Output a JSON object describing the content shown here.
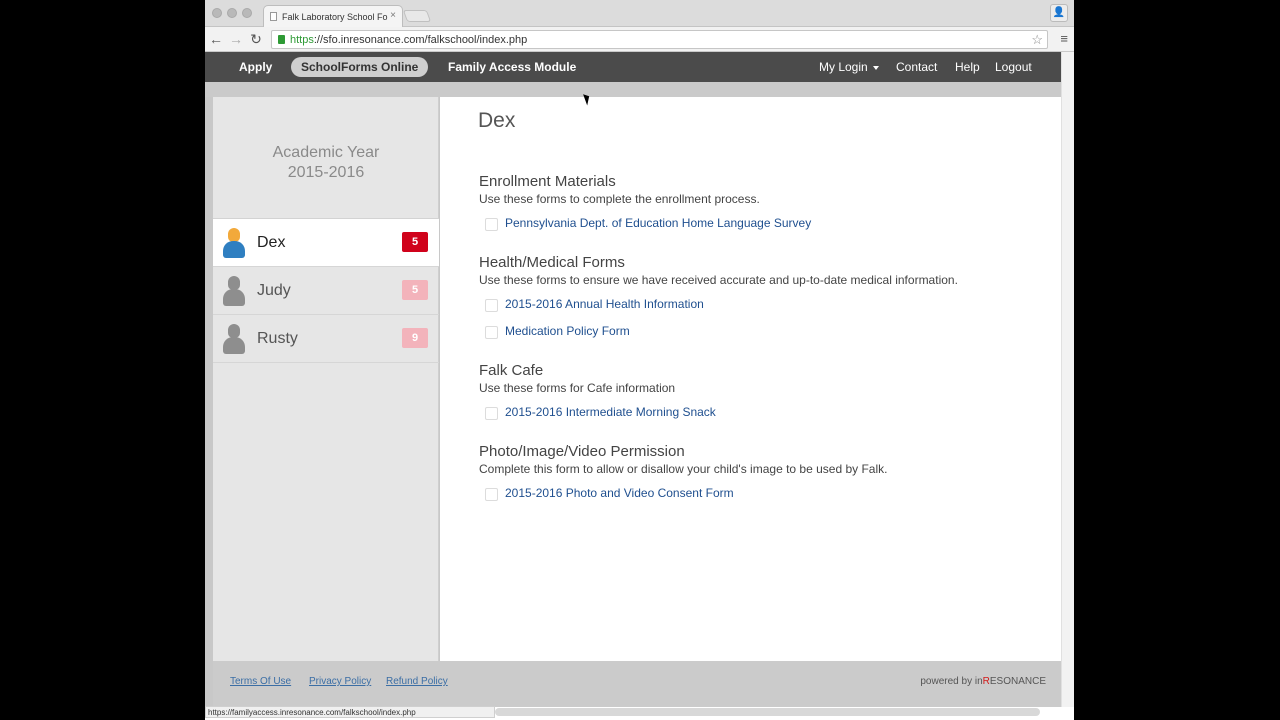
{
  "browser": {
    "tab_title": "Falk Laboratory School Fo",
    "tab_close": "×",
    "url_scheme": "https",
    "url_rest": "://sfo.inresonance.com/falkschool/index.php",
    "back_glyph": "←",
    "forward_glyph": "→",
    "reload_glyph": "↻",
    "star_glyph": "☆",
    "menu_glyph": "≡",
    "profile_glyph": "👤",
    "status_url": "https://familyaccess.inresonance.com/falkschool/index.php"
  },
  "nav": {
    "apply": "Apply",
    "schoolforms": "SchoolForms Online",
    "family_access": "Family Access Module",
    "my_login": "My Login",
    "contact": "Contact",
    "help": "Help",
    "logout": "Logout"
  },
  "sidebar": {
    "year_label": "Academic Year",
    "year_value": "2015-2016",
    "students": [
      {
        "name": "Dex",
        "count": "5",
        "active": true,
        "icon": "person-icon-orange"
      },
      {
        "name": "Judy",
        "count": "5",
        "active": false,
        "icon": "person-icon-grey"
      },
      {
        "name": "Rusty",
        "count": "9",
        "active": false,
        "icon": "person-icon-grey"
      }
    ]
  },
  "main": {
    "student_name": "Dex",
    "sections": [
      {
        "title": "Enrollment Materials",
        "desc": "Use these forms to complete the enrollment process.",
        "forms": [
          "Pennsylvania Dept. of Education Home Language Survey"
        ]
      },
      {
        "title": "Health/Medical Forms",
        "desc": "Use these forms to ensure we have received accurate and up-to-date medical information.",
        "forms": [
          "2015-2016 Annual Health Information",
          "Medication Policy Form"
        ]
      },
      {
        "title": "Falk Cafe",
        "desc": "Use these forms for Cafe information",
        "forms": [
          "2015-2016 Intermediate Morning Snack"
        ]
      },
      {
        "title": "Photo/Image/Video Permission",
        "desc": "Complete this form to allow or disallow your child's image to be used by Falk.",
        "forms": [
          "2015-2016 Photo and Video Consent Form"
        ]
      }
    ]
  },
  "footer": {
    "terms": "Terms Of Use",
    "privacy": "Privacy Policy",
    "refund": "Refund Policy",
    "powered_prefix": "powered by in",
    "powered_brand": "R",
    "powered_suffix": "ESONANCE"
  },
  "colors": {
    "badge_active": "#d0021b",
    "badge_inactive": "#f3b3bb",
    "avatar_active_head": "#f2a93b",
    "avatar_active_body": "#2f7fc1",
    "avatar_inactive": "#8e8e8e"
  }
}
